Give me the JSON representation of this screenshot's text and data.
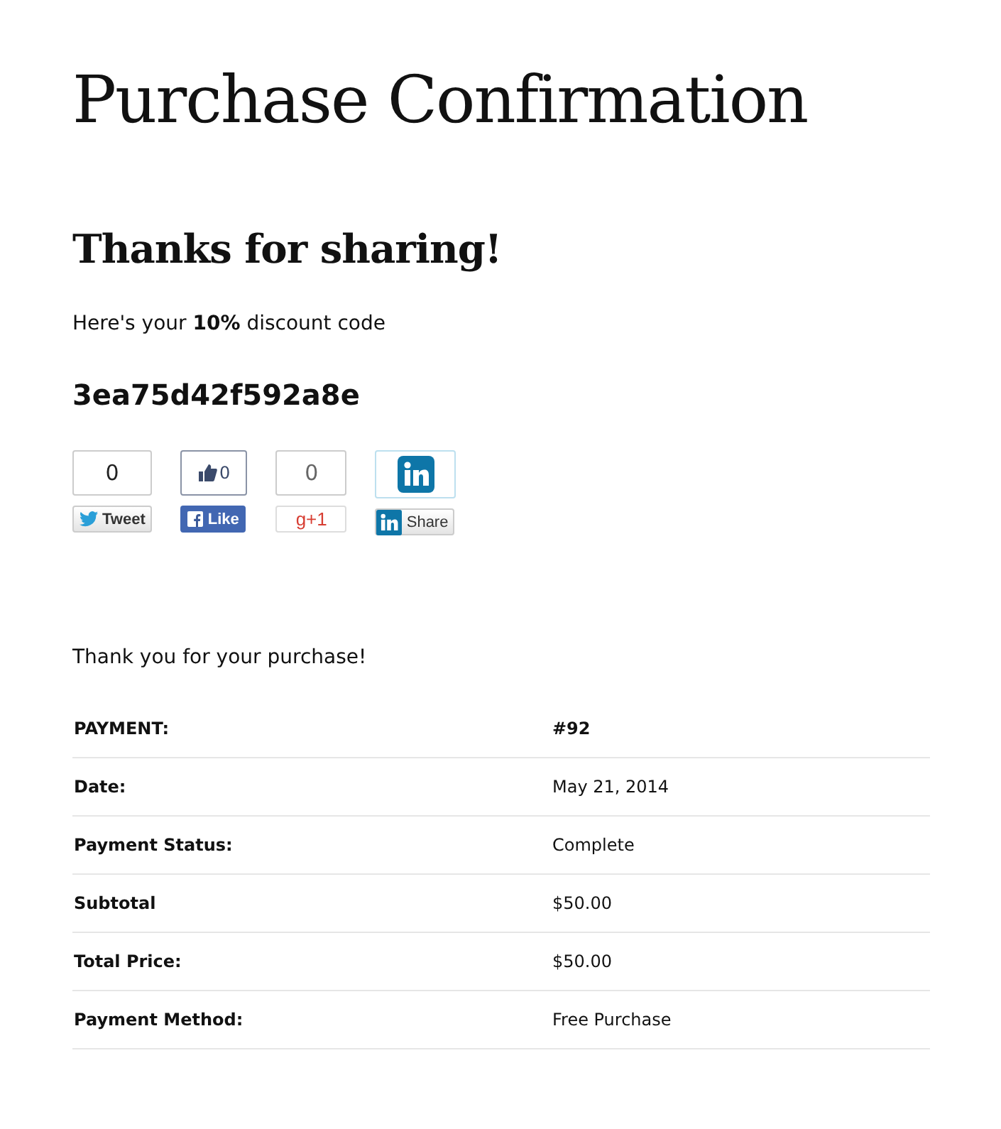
{
  "page_title": "Purchase Confirmation",
  "heading": "Thanks for sharing!",
  "discount_text": "Here's your **10%** discount code",
  "discount_code": "3ea75d42f592a8e",
  "share_buttons": [
    {
      "kind": "twitter",
      "count": "0",
      "label": "Tweet"
    },
    {
      "kind": "facebook",
      "count": "0",
      "label": "Like"
    },
    {
      "kind": "google",
      "count": "0",
      "label": "g+1"
    },
    {
      "kind": "linkedin",
      "label": "Share"
    }
  ],
  "thank_you": "Thank you for your purchase!",
  "table": {
    "rows": [
      {
        "kind": "header",
        "label": "PAYMENT:",
        "value": "#92"
      },
      {
        "kind": "row",
        "label": "Date:",
        "value": "May 21, 2014"
      },
      {
        "kind": "row",
        "label": "Payment Status:",
        "value": "Complete"
      },
      {
        "kind": "row",
        "label": "Subtotal",
        "value": "$50.00"
      },
      {
        "kind": "row",
        "label": "Total Price:",
        "value": "$50.00"
      },
      {
        "kind": "row",
        "label": "Payment Method:",
        "value": "Free Purchase"
      }
    ]
  }
}
